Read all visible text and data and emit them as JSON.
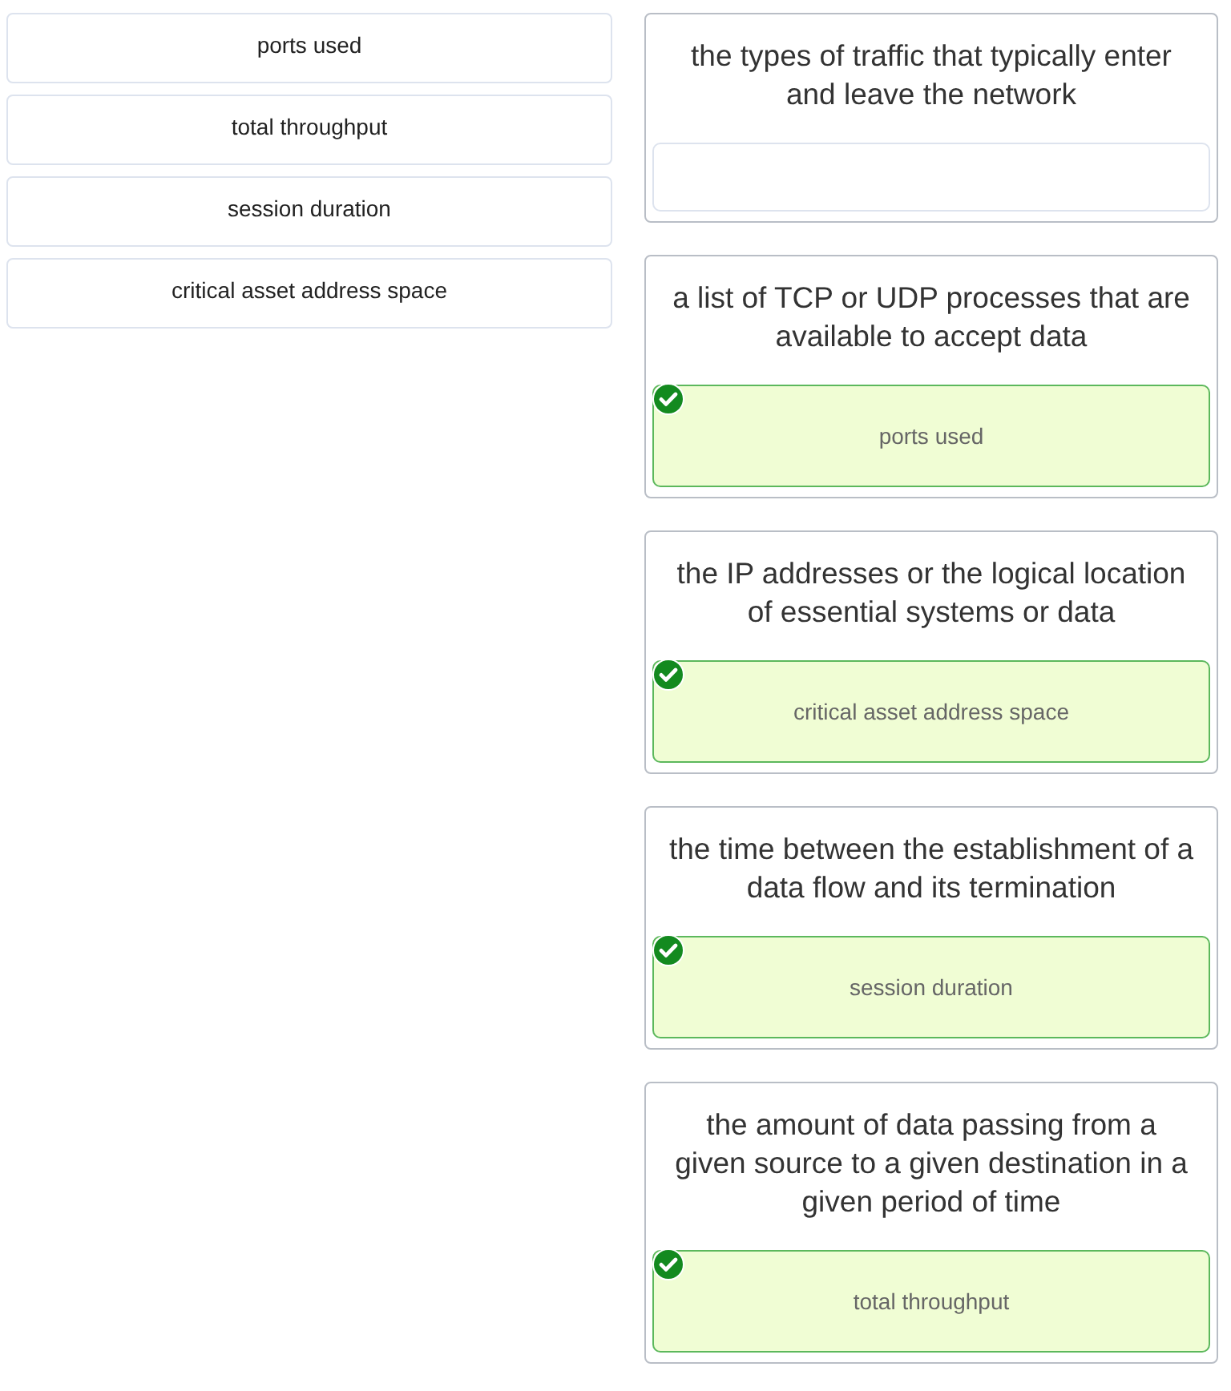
{
  "options": [
    {
      "label": "ports used"
    },
    {
      "label": "total throughput"
    },
    {
      "label": "session duration"
    },
    {
      "label": "critical asset address space"
    }
  ],
  "matches": [
    {
      "prompt": "the types of traffic that typically enter and leave the network"
    },
    {
      "prompt": "a list of TCP or UDP processes that are available to accept data",
      "answer": "ports used",
      "correct": true
    },
    {
      "prompt": "the IP addresses or the logical location of essential systems or data",
      "answer": "critical asset address space",
      "correct": true
    },
    {
      "prompt": "the time between the establishment of a data flow and its termination",
      "answer": "session duration",
      "correct": true
    },
    {
      "prompt": "the amount of data passing from a given source to a given destination in a given period of time",
      "answer": "total throughput",
      "correct": true
    }
  ]
}
